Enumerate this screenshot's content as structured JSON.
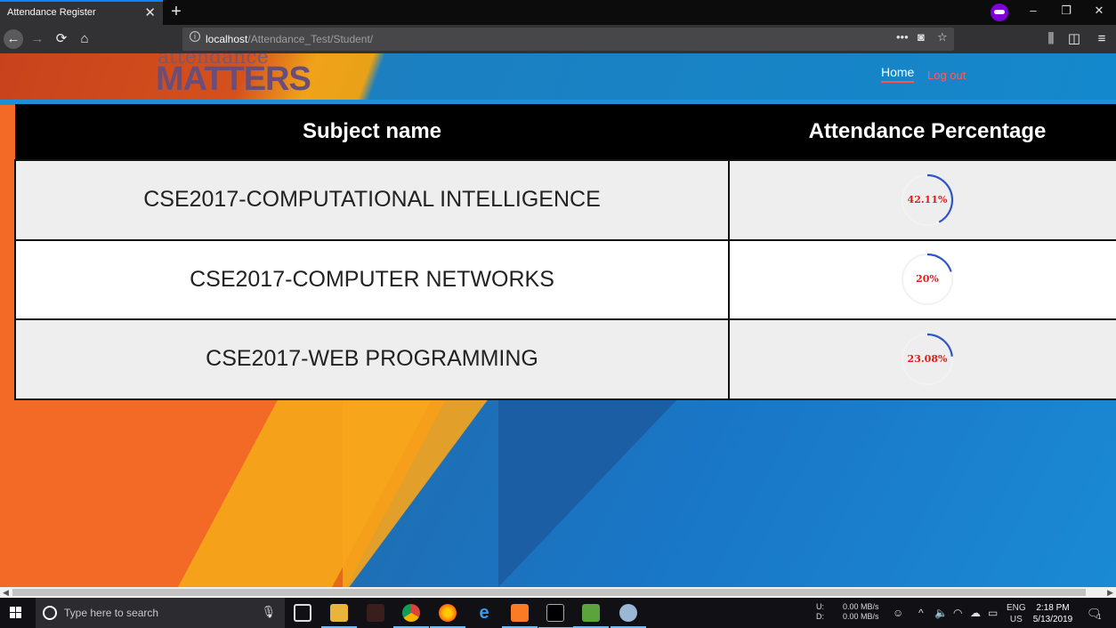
{
  "browser": {
    "tab_title": "Attendance Register",
    "tab_close": "✕",
    "new_tab": "+",
    "url_host": "localhost",
    "url_path": "/Attendance_Test/Student/",
    "window_controls": {
      "minimize": "–",
      "restore": "❐",
      "close": "✕"
    }
  },
  "header": {
    "logo_top": "attendance",
    "logo_main": "MATTERS",
    "nav_home": "Home",
    "nav_logout": "Log out"
  },
  "table": {
    "headers": [
      "Subject name",
      "Attendance Percentage"
    ],
    "rows": [
      {
        "subject": "CSE2017-COMPUTATIONAL INTELLIGENCE",
        "percentage_label": "42.11%",
        "percentage": 42.11
      },
      {
        "subject": "CSE2017-COMPUTER NETWORKS",
        "percentage_label": "20%",
        "percentage": 20
      },
      {
        "subject": "CSE2017-WEB PROGRAMMING",
        "percentage_label": "23.08%",
        "percentage": 23.08
      }
    ]
  },
  "taskbar": {
    "search_placeholder": "Type here to search",
    "net_up_label": "U:",
    "net_down_label": "D:",
    "net_up": "0.00 MB/s",
    "net_down": "0.00 MB/s",
    "lang": "ENG",
    "region": "US",
    "time": "2:18 PM",
    "date": "5/13/2019",
    "notifications_count": "1"
  },
  "colors": {
    "ring_stroke": "#2f55c7",
    "percentage_text": "#e21b1b",
    "header_bg": "#000000"
  }
}
